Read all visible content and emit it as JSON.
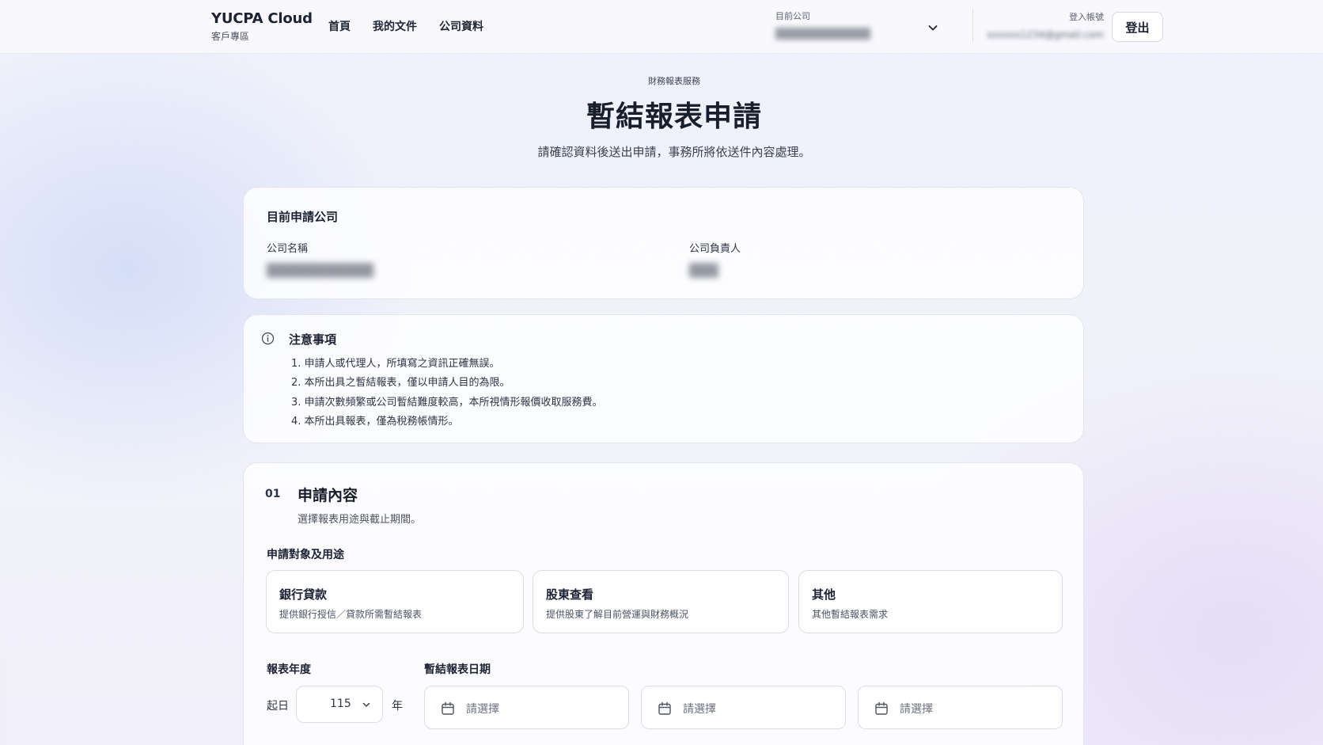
{
  "header": {
    "brand_name": "YUCPA Cloud",
    "brand_sub": "客戶專區",
    "nav": [
      "首頁",
      "我的文件",
      "公司資料"
    ],
    "company_picker_label": "目前公司",
    "company_picker_value": "▒▒▒▒▒▒▒▒▒▒▒▒",
    "account_label": "登入帳號",
    "account_email": "xxxxxx1234@gmail.com",
    "logout_label": "登出"
  },
  "page": {
    "eyebrow": "財務報表服務",
    "title": "暫結報表申請",
    "subtitle": "請確認資料後送出申請，事務所將依送件內容處理。"
  },
  "company_card": {
    "title": "目前申請公司",
    "name_label": "公司名稱",
    "name_value": "▒▒▒▒▒▒▒▒▒▒▒",
    "owner_label": "公司負責人",
    "owner_value": "▒▒▒"
  },
  "notice": {
    "title": "注意事項",
    "items": [
      "1. 申請人或代理人，所填寫之資訊正確無誤。",
      "2. 本所出具之暫結報表，僅以申請人目的為限。",
      "3. 申請次數頻繁或公司暫結難度較高，本所視情形報價收取服務費。",
      "4. 本所出具報表，僅為稅務帳情形。"
    ]
  },
  "form": {
    "step_num": "01",
    "step_title": "申請內容",
    "step_sub": "選擇報表用途與截止期間。",
    "purpose_label": "申請對象及用途",
    "options": [
      {
        "title": "銀行貸款",
        "desc": "提供銀行授信／貸款所需暫結報表"
      },
      {
        "title": "股東查看",
        "desc": "提供股東了解目前營運與財務概況"
      },
      {
        "title": "其他",
        "desc": "其他暫結報表需求"
      }
    ],
    "year_label": "報表年度",
    "start_label": "起日",
    "year_value": "115",
    "year_unit": "年",
    "date_label": "暫結報表日期",
    "date_placeholder": "請選擇"
  },
  "colors": {
    "text_primary": "#1b2233",
    "border": "#d9dde6",
    "card_bg": "#ffffff"
  }
}
